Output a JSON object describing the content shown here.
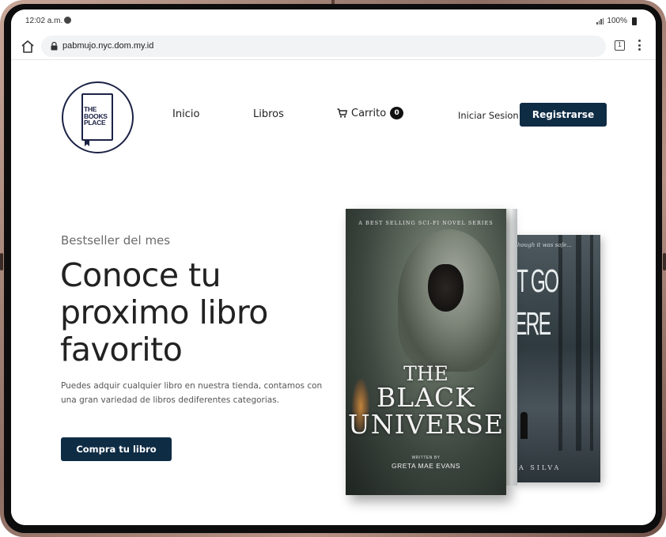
{
  "status_bar": {
    "time": "12:02 a.m.",
    "battery": "100%"
  },
  "browser": {
    "url": "pabmujo.nyc.dom.my.id",
    "tab_count": "1"
  },
  "header": {
    "logo_lines": [
      "THE",
      "BOOKS",
      "PLACE"
    ],
    "nav": {
      "home": "Inicio",
      "books": "Libros",
      "cart": "Carrito",
      "cart_count": "0"
    },
    "login_label": "Iniciar Sesion",
    "register_label": "Registrarse"
  },
  "hero": {
    "eyebrow": "Bestseller del mes",
    "title": "Conoce tu proximo libro favorito",
    "description": "Puedes adquir cualquier libro en nuestra tienda, contamos con una gran variedad de libros dediferentes categorias.",
    "cta_label": "Compra tu libro"
  },
  "books": {
    "front": {
      "tagline": "A BEST SELLING SCI-FI NOVEL SERIES",
      "title_lines": [
        "THE",
        "BLACK",
        "UNIVERSE"
      ],
      "written_by": "WRITTEN BY",
      "author": "GRETA MAE EVANS"
    },
    "back": {
      "tagline": "hough it was safe...",
      "title_lines": [
        "'T GO",
        "ERE"
      ],
      "author": "A SILVA"
    }
  },
  "colors": {
    "primary": "#0f2c45",
    "logo": "#1c2245",
    "device_frame": "#b99386"
  }
}
